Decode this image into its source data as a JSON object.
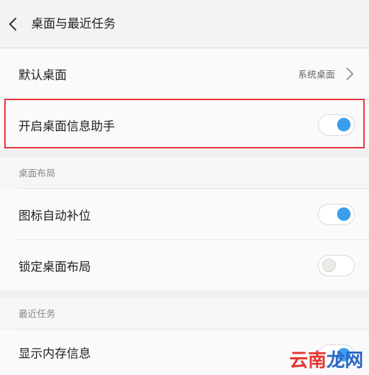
{
  "header": {
    "title": "桌面与最近任务"
  },
  "default_desktop": {
    "label": "默认桌面",
    "value": "系统桌面"
  },
  "desktop_assistant": {
    "label": "开启桌面信息助手",
    "enabled": true
  },
  "section_layout": {
    "title": "桌面布局",
    "items": [
      {
        "label": "图标自动补位",
        "enabled": true
      },
      {
        "label": "锁定桌面布局",
        "enabled": false
      }
    ]
  },
  "section_recent": {
    "title": "最近任务",
    "items": [
      {
        "label": "显示内存信息",
        "enabled": true
      }
    ]
  },
  "watermark": {
    "part1": "云南",
    "part2": "龙网"
  },
  "colors": {
    "switch_on": "#3b9eea",
    "highlight": "#e3343a"
  }
}
